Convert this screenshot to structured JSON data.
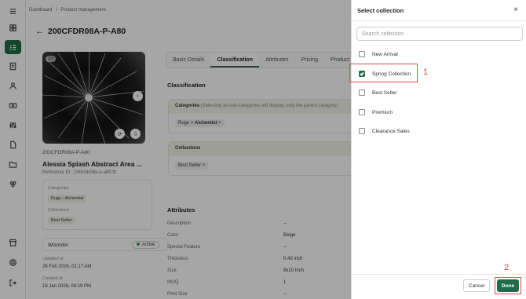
{
  "breadcrumb": {
    "root": "Dashboard",
    "sep": "/",
    "current": "Product management"
  },
  "page": {
    "title": "200CFDR08A-P-A80"
  },
  "product": {
    "img_badge": "1/3",
    "sku": "200CFDR08A-P-A80",
    "name": "Alessia Splash Abstract Area ...",
    "ref_id": "Reference ID : 200cfdr08a-p-a80",
    "categories_label": "Categories",
    "category_path": [
      "Rugs",
      "Alchemist"
    ],
    "collections_label": "Collections",
    "collection_tag": "Best Seller",
    "wizorder_label": "Wizorder",
    "wizorder_status": "Active",
    "updated_label": "Updated at",
    "updated_value": "26 Feb 2026, 01:17 AM",
    "created_label": "Created at",
    "created_value": "19 Jan 2026, 06:19 PM"
  },
  "tabs": [
    "Basic Details",
    "Classification",
    "Attributes",
    "Pricing",
    "Product"
  ],
  "classification": {
    "title": "Classification",
    "categories_head": "Categories",
    "categories_note": "(Selecting all sub-categories will display, only the parent category)",
    "category_tag_a": "Rugs",
    "category_tag_sep": ">",
    "category_tag_b": "Alchemist",
    "collections_head": "Collections",
    "collection_tag": "Best Seller"
  },
  "attributes": {
    "title": "Attributes",
    "rows": [
      {
        "k": "Description",
        "v": "--"
      },
      {
        "k": "Color",
        "v": "Beige"
      },
      {
        "k": "Special Feature",
        "v": "--"
      },
      {
        "k": "Thickness",
        "v": "0.40 inch"
      },
      {
        "k": "Size",
        "v": "8x10 Inch"
      },
      {
        "k": "MOQ",
        "v": "1"
      },
      {
        "k": "Print Size",
        "v": "--"
      }
    ]
  },
  "drawer": {
    "title": "Select collection",
    "close": "×",
    "search_placeholder": "Search collection",
    "options": [
      {
        "label": "New Arrival",
        "checked": false
      },
      {
        "label": "Spring Collection",
        "checked": true
      },
      {
        "label": "Best Seller",
        "checked": false
      },
      {
        "label": "Premium",
        "checked": false
      },
      {
        "label": "Clearance Sales",
        "checked": false
      }
    ],
    "cancel": "Cancel",
    "done": "Done"
  },
  "annotations": {
    "step1": "1",
    "step2": "2"
  },
  "colors": {
    "primary": "#1f6b4a",
    "annotation": "#e14a4a"
  }
}
